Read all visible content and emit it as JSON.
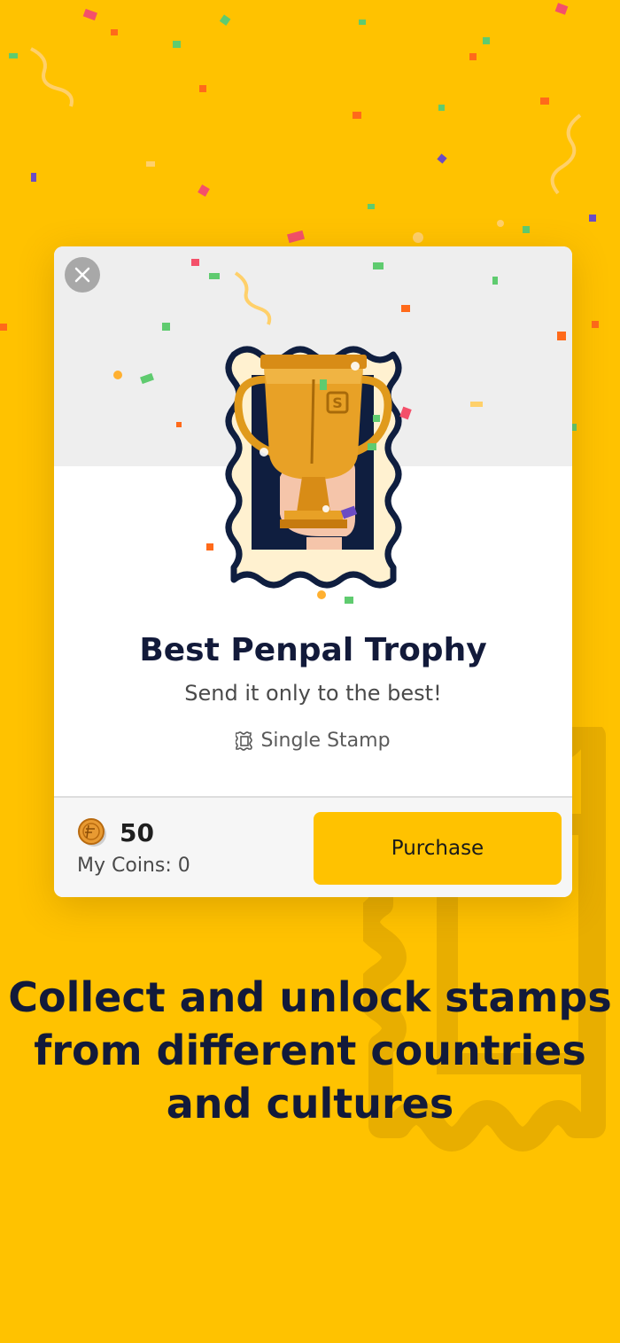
{
  "modal": {
    "title": "Best Penpal Trophy",
    "subtitle": "Send it only to the best!",
    "type_label": "Single Stamp",
    "type_icon": "stamp-outline-icon",
    "close_icon": "close-icon"
  },
  "footer": {
    "price": "50",
    "coin_icon": "coin-icon",
    "my_coins": "My Coins: 0",
    "purchase_label": "Purchase"
  },
  "promo": {
    "line1": "Collect and unlock stamps",
    "line2": "from different countries",
    "line3": "and cultures"
  },
  "colors": {
    "background": "#FFC200",
    "primary_button": "#FFC200",
    "title_text": "#121a3a",
    "stamp_frame": "#0f1e3f",
    "trophy": "#E09A1C"
  }
}
